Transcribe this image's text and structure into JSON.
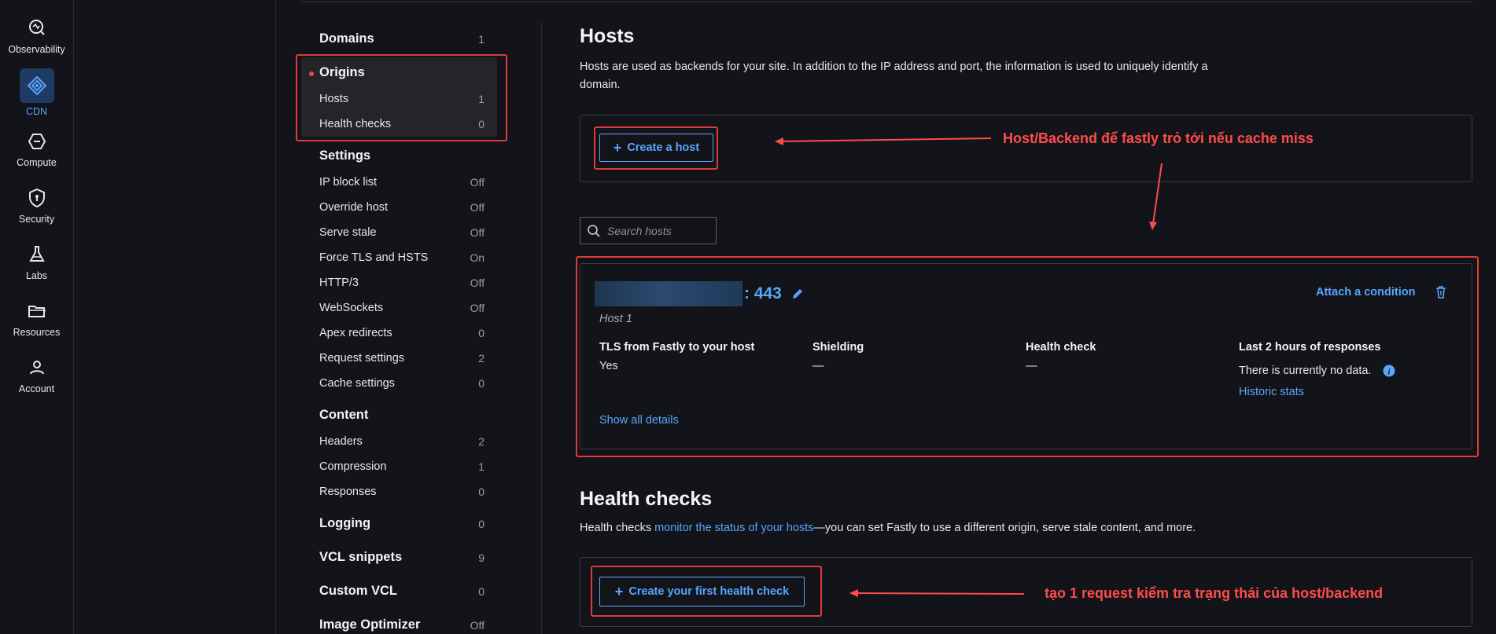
{
  "rail": {
    "items": [
      {
        "label": "Observability",
        "icon": "observability-icon"
      },
      {
        "label": "CDN",
        "icon": "cdn-icon",
        "active": true
      },
      {
        "label": "Compute",
        "icon": "compute-icon"
      },
      {
        "label": "Security",
        "icon": "security-icon"
      },
      {
        "label": "Labs",
        "icon": "labs-icon"
      },
      {
        "label": "Resources",
        "icon": "folder-icon"
      },
      {
        "label": "Account",
        "icon": "account-icon"
      }
    ]
  },
  "nav": {
    "domains": {
      "label": "Domains",
      "count": "1"
    },
    "origins": {
      "label": "Origins",
      "hosts": {
        "label": "Hosts",
        "count": "1"
      },
      "health": {
        "label": "Health checks",
        "count": "0"
      }
    },
    "settings": {
      "label": "Settings",
      "items": [
        {
          "label": "IP block list",
          "value": "Off"
        },
        {
          "label": "Override host",
          "value": "Off"
        },
        {
          "label": "Serve stale",
          "value": "Off"
        },
        {
          "label": "Force TLS and HSTS",
          "value": "On"
        },
        {
          "label": "HTTP/3",
          "value": "Off"
        },
        {
          "label": "WebSockets",
          "value": "Off"
        },
        {
          "label": "Apex redirects",
          "value": "0"
        },
        {
          "label": "Request settings",
          "value": "2"
        },
        {
          "label": "Cache settings",
          "value": "0"
        }
      ]
    },
    "content": {
      "label": "Content",
      "items": [
        {
          "label": "Headers",
          "value": "2"
        },
        {
          "label": "Compression",
          "value": "1"
        },
        {
          "label": "Responses",
          "value": "0"
        }
      ]
    },
    "logging": {
      "label": "Logging",
      "count": "0"
    },
    "vcl_snippets": {
      "label": "VCL snippets",
      "count": "9"
    },
    "custom_vcl": {
      "label": "Custom VCL",
      "count": "0"
    },
    "image_optimizer": {
      "label": "Image Optimizer",
      "count": "Off"
    }
  },
  "hosts": {
    "title": "Hosts",
    "description_line1": "Hosts are used as backends for your site. In addition to the IP address and port, the information is used to uniquely identify a",
    "description_line2": "domain.",
    "create_button": "Create a host",
    "search_placeholder": "Search hosts",
    "host": {
      "port": ": 443",
      "name": "Host 1",
      "attach_condition": "Attach a condition",
      "tls_label": "TLS from Fastly to your host",
      "tls_value": "Yes",
      "shielding_label": "Shielding",
      "shielding_value": "—",
      "health_label": "Health check",
      "health_value": "—",
      "responses_label": "Last 2 hours of responses",
      "responses_value": "There is currently no data.",
      "historic_stats": "Historic stats",
      "show_all": "Show all details"
    }
  },
  "health": {
    "title": "Health checks",
    "desc_prefix": "Health checks ",
    "desc_link": "monitor the status of your hosts",
    "desc_suffix": "—you can set Fastly to use a different origin, serve stale content, and more.",
    "create_button": "Create your first health check"
  },
  "annotations": {
    "host_note": "Host/Backend để fastly trỏ tới nếu cache miss",
    "health_note": "tạo 1 request kiểm tra trạng thái của host/backend"
  },
  "colors": {
    "accent": "#58a6ff",
    "annotation": "#ff4b4b",
    "background": "#131419"
  }
}
